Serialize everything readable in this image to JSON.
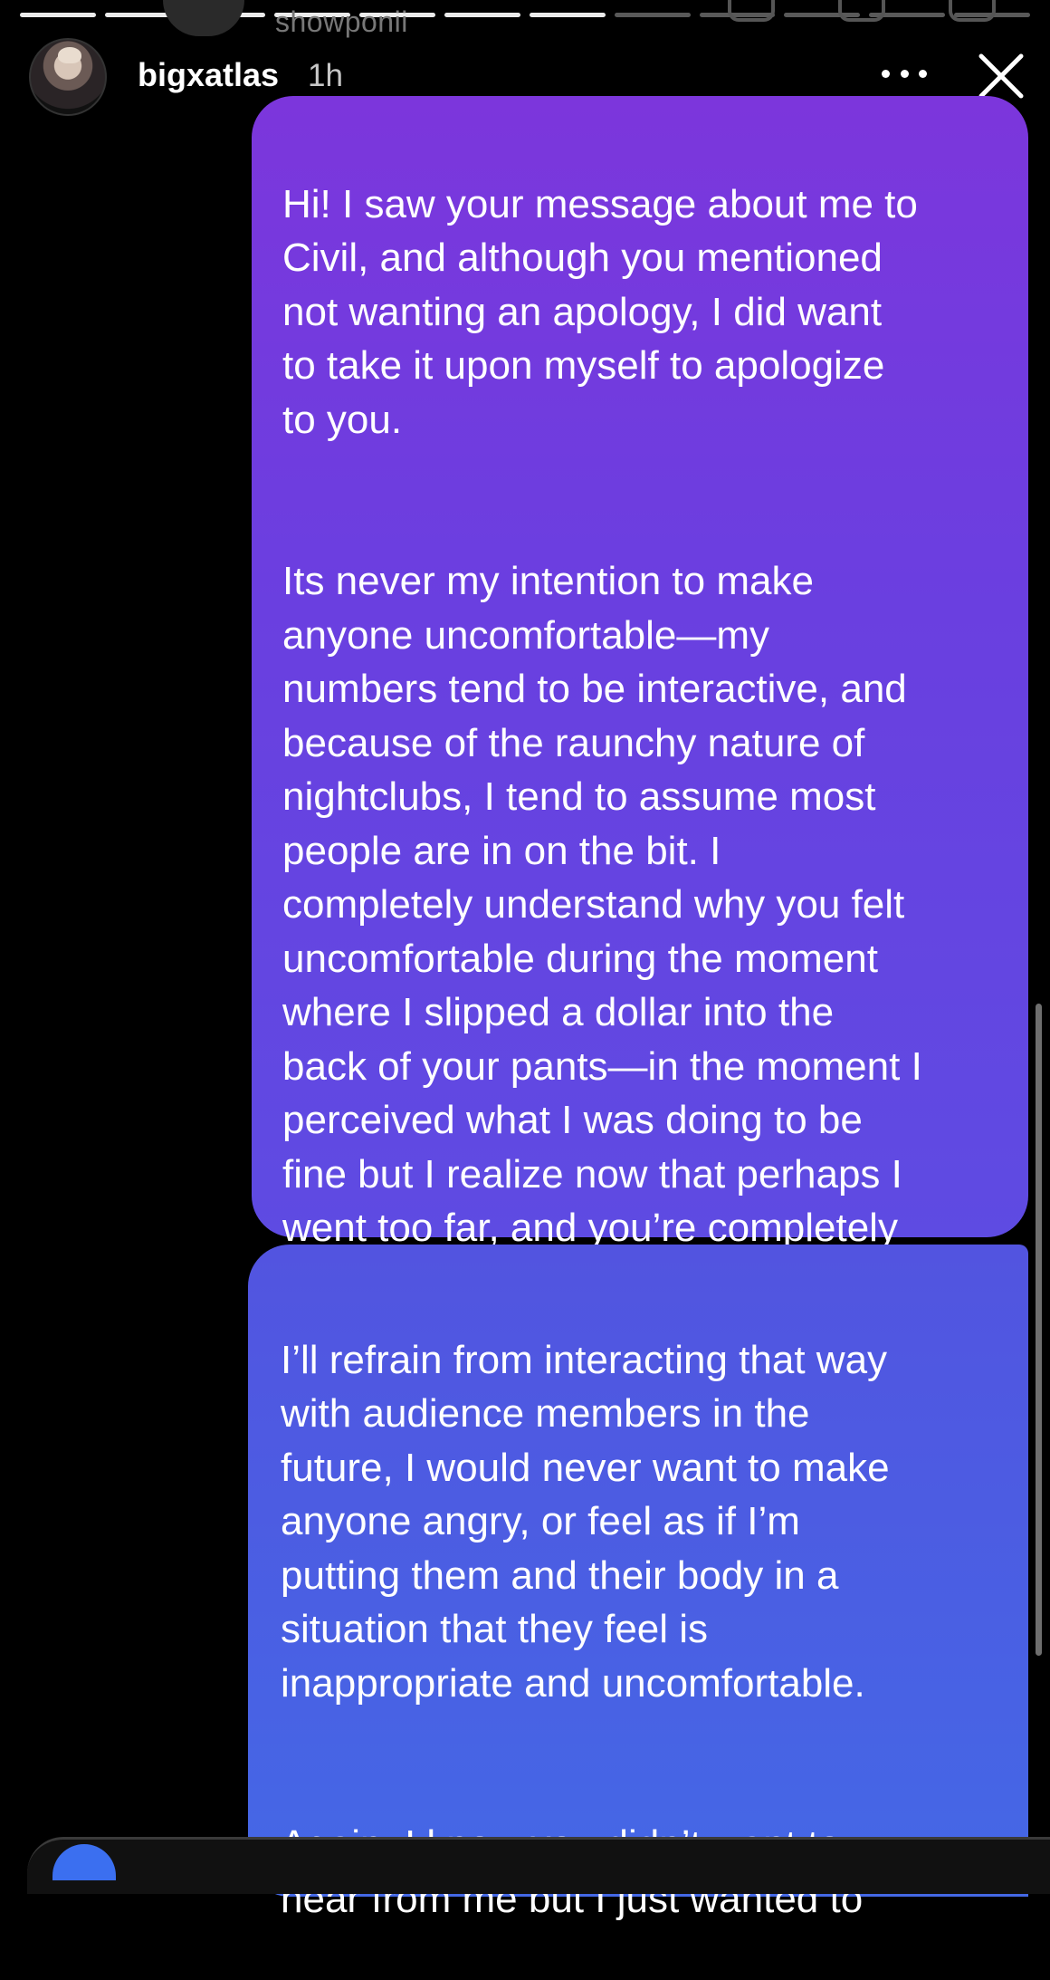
{
  "background": {
    "username": "showponii"
  },
  "story": {
    "progress_segments": [
      true,
      true,
      true,
      true,
      true,
      true,
      true,
      false,
      false,
      false,
      false,
      false
    ]
  },
  "header": {
    "username": "bigxatlas",
    "time": "1h",
    "more_icon": "more-horizontal-icon",
    "close_icon": "close-icon"
  },
  "messages": [
    {
      "paragraphs": [
        "Hi! I saw your message about me to\nCivil, and although you mentioned\nnot wanting an apology, I did want\nto take it upon myself to apologize\nto you.",
        "Its never my intention to make\nanyone uncomfortable—my\nnumbers tend to be interactive, and\nbecause of the raunchy nature of\nnightclubs, I tend to assume most\npeople are in on the bit. I\ncompletely understand why you felt\nuncomfortable during the moment\nwhere I slipped a dollar into the\nback of your pants—in the moment I\nperceived what I was doing to be\nfine but I realize now that perhaps I\nwent too far, and you’re completely\njustified in feeling how you feel."
      ]
    },
    {
      "paragraphs": [
        "I’ll refrain from interacting that way\nwith audience members in the\nfuture, I would never want to make\nanyone angry, or feel as if I’m\nputting them and their body in a\nsituation that they feel is\ninappropriate and uncomfortable.",
        "Again, I know you didn’t want to\nhear from me but I just wanted to"
      ]
    }
  ],
  "colors": {
    "bubble_top": "#7c36dc",
    "bubble_bottom": "#4468e6",
    "background": "#000000"
  }
}
